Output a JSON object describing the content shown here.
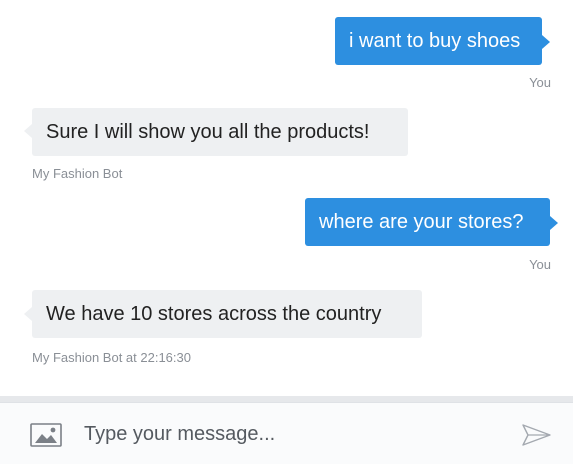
{
  "messages": [
    {
      "sender": "user",
      "text": "i want to buy shoes",
      "meta": "You"
    },
    {
      "sender": "bot",
      "text": "Sure I will show you all the products!",
      "meta": "My Fashion Bot"
    },
    {
      "sender": "user",
      "text": "where are your stores?",
      "meta": "You"
    },
    {
      "sender": "bot",
      "text": "We have 10 stores across the country",
      "meta": "My Fashion Bot at 22:16:30"
    }
  ],
  "composer": {
    "placeholder": "Type your message...",
    "attach_icon": "image-icon",
    "send_icon": "send-icon"
  },
  "colors": {
    "user_bubble": "#2d8fe0",
    "bot_bubble": "#eef0f2",
    "meta_text": "#8a8f96"
  }
}
